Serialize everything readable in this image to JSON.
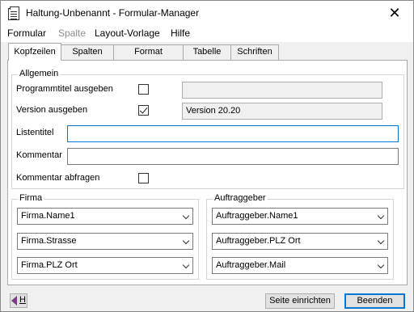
{
  "window": {
    "title": "Haltung-Unbenannt - Formular-Manager",
    "close_symbol": "✕"
  },
  "menu": {
    "items": [
      {
        "label": "Formular",
        "enabled": true
      },
      {
        "label": "Spalte",
        "enabled": false
      },
      {
        "label": "Layout-Vorlage",
        "enabled": true
      },
      {
        "label": "Hilfe",
        "enabled": true
      }
    ]
  },
  "tabs": [
    {
      "label": "Kopfzeilen",
      "active": true
    },
    {
      "label": "Spalten",
      "active": false
    },
    {
      "label": "Format",
      "active": false
    },
    {
      "label": "Tabelle",
      "active": false
    },
    {
      "label": "Schriften",
      "active": false
    }
  ],
  "allgemein": {
    "title": "Allgemein",
    "programmtitel_label": "Programmtitel ausgeben",
    "programmtitel_checked": false,
    "programmtitel_value": "",
    "version_label": "Version ausgeben",
    "version_checked": true,
    "version_value": "Version 20.20",
    "listentitel_label": "Listentitel",
    "listentitel_value": "",
    "kommentar_label": "Kommentar",
    "kommentar_value": "",
    "kommentar_abfragen_label": "Kommentar abfragen",
    "kommentar_abfragen_checked": false
  },
  "firma": {
    "title": "Firma",
    "fields": [
      "Firma.Name1",
      "Firma.Strasse",
      "Firma.PLZ Ort"
    ]
  },
  "auftraggeber": {
    "title": "Auftraggeber",
    "fields": [
      "Auftraggeber.Name1",
      "Auftraggeber.PLZ Ort",
      "Auftraggeber.Mail"
    ]
  },
  "footer": {
    "help_label": "H",
    "help_icon": "help-book-icon",
    "seite_einrichten_label": "Seite einrichten",
    "beenden_label": "Beenden"
  },
  "colors": {
    "focus_border": "#0078d7",
    "dialog_background": "#f0f0f0",
    "disabled_text": "#8d8d8d"
  }
}
